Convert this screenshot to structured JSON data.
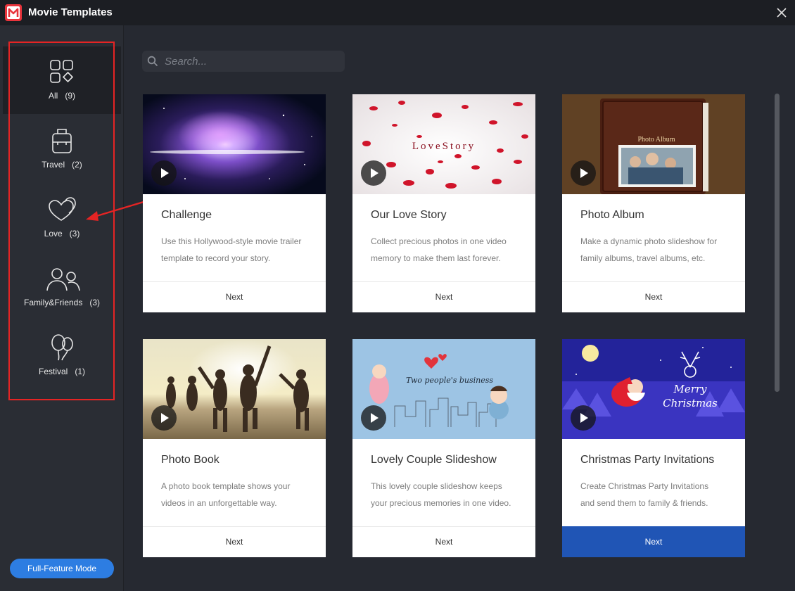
{
  "window": {
    "title": "Movie Templates"
  },
  "sidebar": {
    "items": [
      {
        "name": "All",
        "count": "(9)",
        "label": "All   (9)",
        "icon": "grid-icon",
        "active": true
      },
      {
        "name": "Travel",
        "count": "(2)",
        "label": "Travel   (2)",
        "icon": "luggage-icon"
      },
      {
        "name": "Love",
        "count": "(3)",
        "label": "Love   (3)",
        "icon": "hearts-icon"
      },
      {
        "name": "Family&Friends",
        "count": "(3)",
        "label": "Family&Friends   (3)",
        "icon": "people-icon"
      },
      {
        "name": "Festival",
        "count": "(1)",
        "label": "Festival   (1)",
        "icon": "balloons-icon"
      }
    ],
    "full_feature_label": "Full-Feature Mode"
  },
  "search": {
    "placeholder": "Search..."
  },
  "templates": [
    {
      "title": "Challenge",
      "desc_line1": "Use this Hollywood-style movie trailer",
      "desc_line2": "template to record your story.",
      "next": "Next",
      "thumb": "galaxy"
    },
    {
      "title": "Our Love Story",
      "desc_line1": "Collect precious photos in one video",
      "desc_line2": "memory to make them last forever.",
      "next": "Next",
      "thumb": "rose petals",
      "thumb_text": "LoveStory"
    },
    {
      "title": "Photo Album",
      "desc_line1": "Make a dynamic photo slideshow for",
      "desc_line2": "family albums, travel albums, etc.",
      "next": "Next",
      "thumb": "leather album",
      "thumb_text": "Photo Album"
    },
    {
      "title": "Photo Book",
      "desc_line1": "A photo book template shows your",
      "desc_line2": "videos in an unforgettable way.",
      "next": "Next",
      "thumb": "beach friends"
    },
    {
      "title": "Lovely Couple Slideshow",
      "desc_line1": "This lovely couple slideshow keeps",
      "desc_line2": "your precious memories in one video.",
      "next": "Next",
      "thumb": "cartoon couple",
      "thumb_text": "Two people's business"
    },
    {
      "title": "Christmas Party Invitations",
      "desc_line1": "Create Christmas Party Invitations",
      "desc_line2": "and send them to family & friends.",
      "next": "Next",
      "thumb": "christmas",
      "thumb_text_1": "Merry",
      "thumb_text_2": "Christmas",
      "selected": true
    }
  ],
  "colors": {
    "accent_blue": "#2d7de2",
    "selected_next": "#2055b5",
    "highlight_red": "#e52424",
    "background": "#262931"
  }
}
